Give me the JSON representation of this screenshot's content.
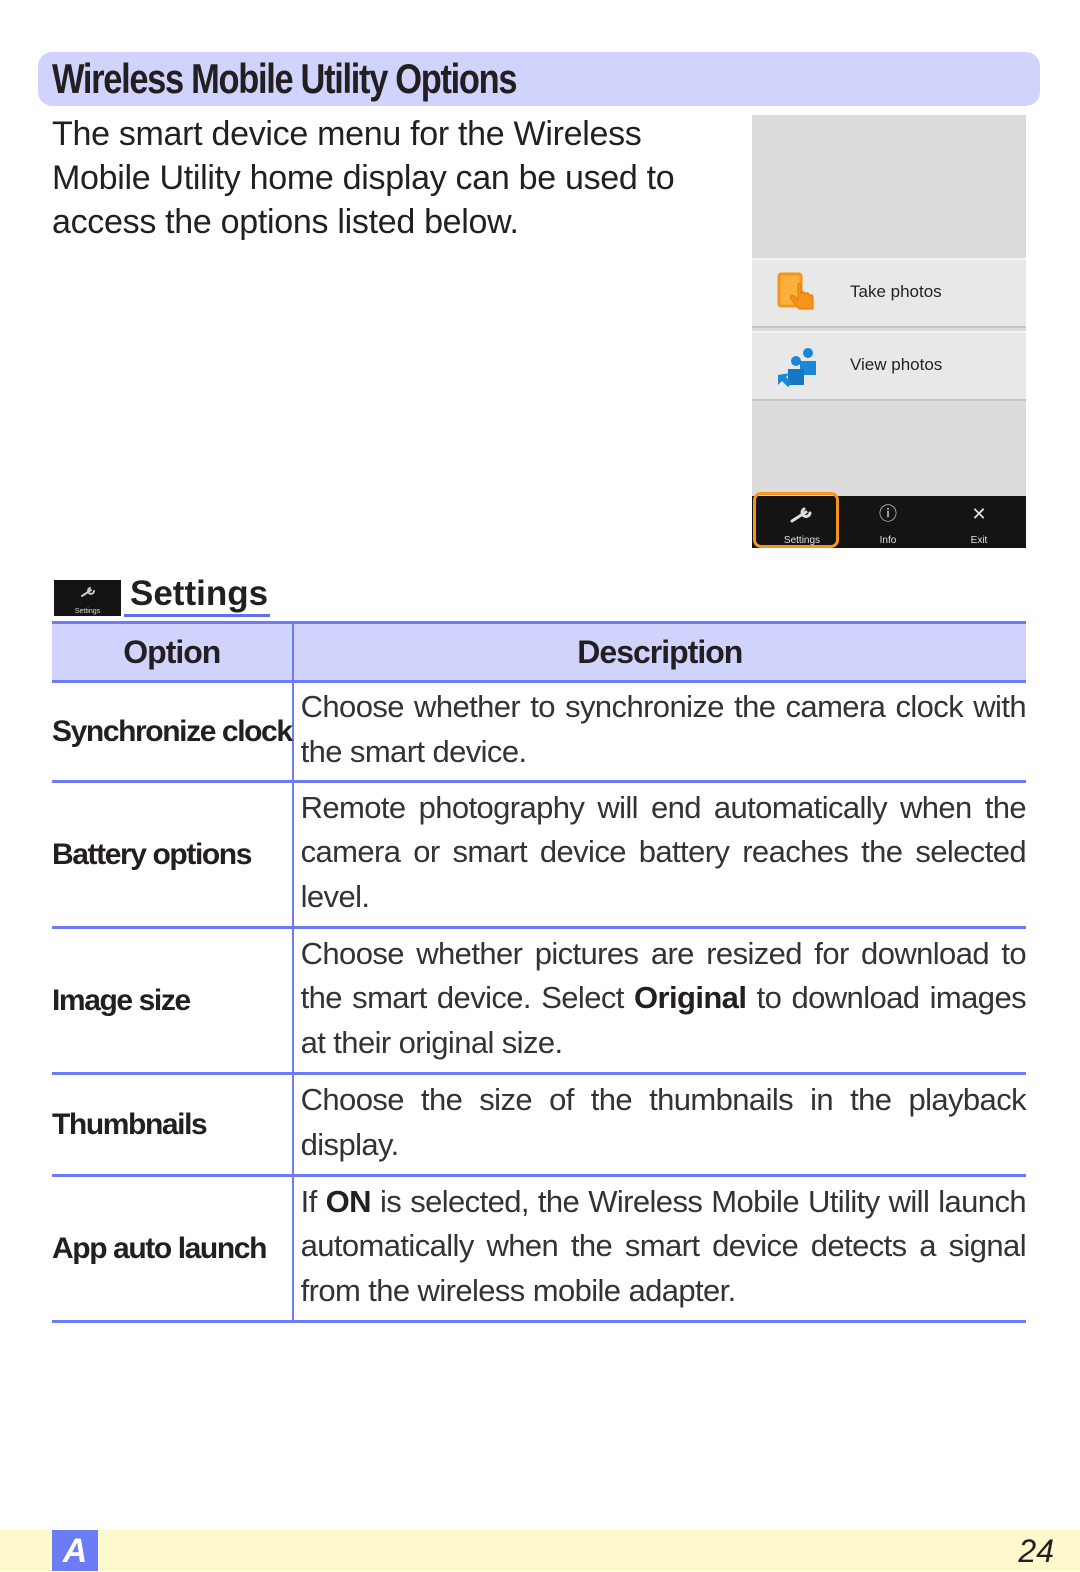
{
  "page": {
    "title": "Wireless Mobile Utility Options",
    "intro": "The smart device menu for the Wireless Mobile Utility home display can be used to access the options listed below."
  },
  "phone_screen": {
    "menu_items": [
      {
        "label": "Take photos",
        "icon": "take-photos-icon"
      },
      {
        "label": "View photos",
        "icon": "view-photos-icon"
      }
    ],
    "toolbar": [
      {
        "label": "Settings",
        "icon": "wrench-icon",
        "highlighted": true
      },
      {
        "label": "Info",
        "icon": "info-icon"
      },
      {
        "label": "Exit",
        "icon": "close-icon"
      }
    ],
    "highlight_color": "#f7941d"
  },
  "settings": {
    "heading": "Settings",
    "icon_label": "Settings",
    "table": {
      "headers": [
        "Option",
        "Description"
      ],
      "rows": [
        {
          "option": "Synchronize clock",
          "description_html": "Choose whether to synchronize the camera clock with the smart device."
        },
        {
          "option": "Battery options",
          "description_html": "Remote photography will end automatically when the camera or smart device battery reaches the selected level."
        },
        {
          "option": "Image size",
          "description_pre": "Choose whether pictures are resized for download to the smart device. Select ",
          "description_bold": "Original",
          "description_post": " to download images at their original size."
        },
        {
          "option": "Thumbnails",
          "description_html": "Choose the size of the thumbnails in the playback display."
        },
        {
          "option": "App auto launch",
          "description_pre": "If ",
          "description_bold": "ON",
          "description_post": " is selected, the Wireless Mobile Utility will launch automatically when the smart device detects a signal from the wireless mobile adapter."
        }
      ]
    }
  },
  "footer": {
    "section_tab": "A",
    "page_number": "24"
  },
  "colors": {
    "accent_blue": "#6b7cf4",
    "header_fill": "#d0d4fc",
    "footer_fill": "#fef8cd"
  }
}
